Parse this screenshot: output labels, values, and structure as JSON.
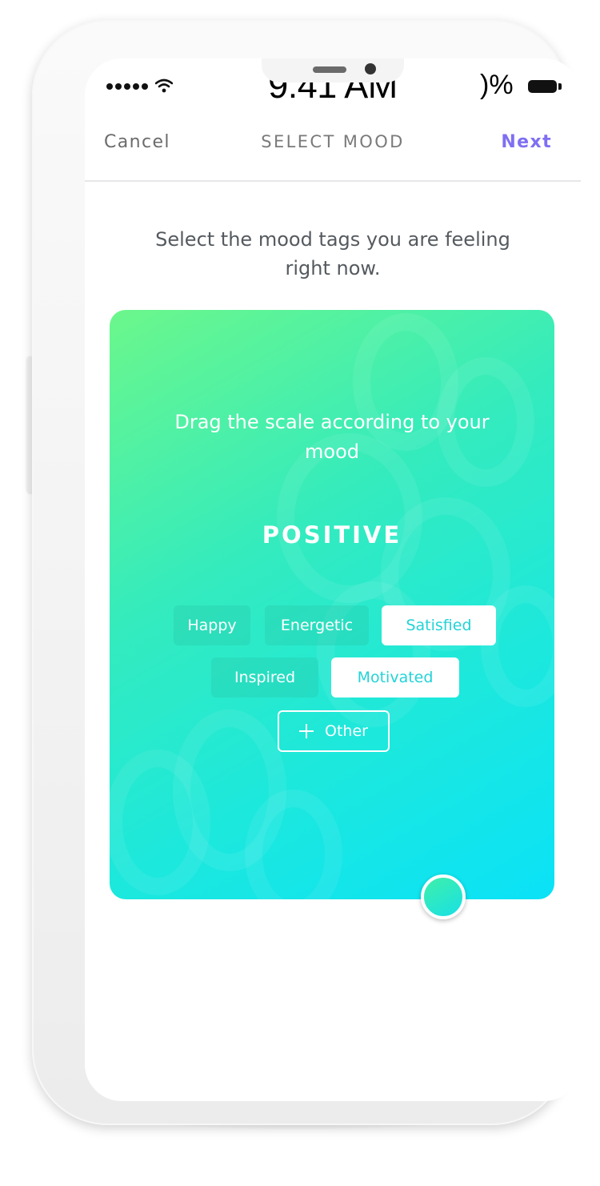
{
  "status_bar": {
    "time": "9:41 AM",
    "battery": ")%"
  },
  "nav": {
    "cancel_label": "Cancel",
    "title": "SELECT MOOD",
    "next_label": "Next"
  },
  "instruction": "Select the mood tags you are feeling right now.",
  "card": {
    "hint": "Drag the scale according to your mood",
    "mood": "POSITIVE",
    "tags": [
      {
        "label": "Happy",
        "selected": false
      },
      {
        "label": "Energetic",
        "selected": false
      },
      {
        "label": "Satisfied",
        "selected": true
      },
      {
        "label": "Inspired",
        "selected": false
      },
      {
        "label": "Motivated",
        "selected": true
      }
    ],
    "other_label": "Other"
  },
  "icons": {
    "signal": "signal-dots-icon",
    "wifi": "wifi-icon",
    "battery": "battery-icon",
    "add": "plus-icon"
  },
  "colors": {
    "accent": "#7f6ff2",
    "gradient_start": "#6cf78b",
    "gradient_end": "#0ae2f7",
    "selected_tag_text": "#22d3d7"
  }
}
